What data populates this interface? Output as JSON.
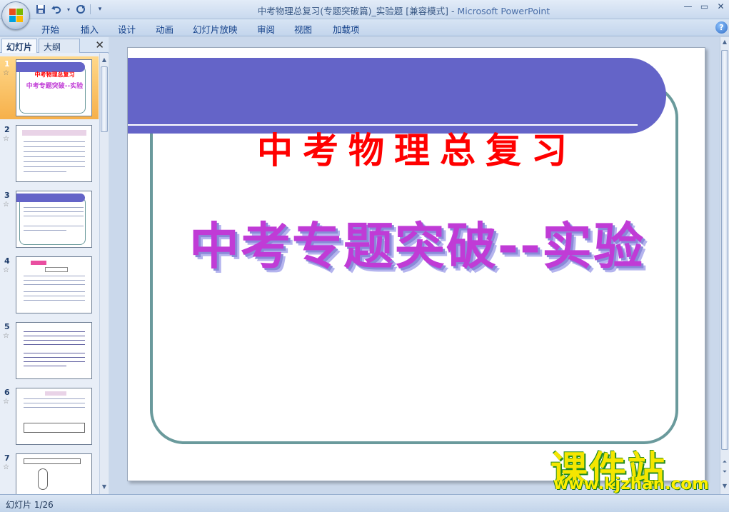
{
  "window": {
    "title": "中考物理总复习(专题突破篇)_实验题 [兼容模式]",
    "separator": " - ",
    "app_name": "Microsoft PowerPoint"
  },
  "qat": {
    "save_icon": "save-icon",
    "undo_icon": "undo-icon",
    "redo_icon": "redo-icon",
    "customize_icon": "customize-icon"
  },
  "ribbon": {
    "tabs": [
      "开始",
      "插入",
      "设计",
      "动画",
      "幻灯片放映",
      "审阅",
      "视图",
      "加载项"
    ],
    "help_label": "?"
  },
  "left_pane": {
    "tab_slides": "幻灯片",
    "tab_outline": "大纲",
    "close_label": "✕",
    "thumbnails": [
      {
        "num": "1",
        "selected": true
      },
      {
        "num": "2"
      },
      {
        "num": "3"
      },
      {
        "num": "4"
      },
      {
        "num": "5"
      },
      {
        "num": "6"
      },
      {
        "num": "7"
      }
    ],
    "thumb1_title": "中考物理总复习",
    "thumb1_subtitle": "中考专题突破--实验"
  },
  "slide": {
    "title": "中考物理总复习",
    "subtitle": "中考专题突破--实验",
    "colors": {
      "banner": "#6464c8",
      "title": "#ff0000",
      "subtitle": "#c03bd6",
      "frame": "#6a9a9c"
    }
  },
  "watermark": {
    "line1": "课件站",
    "line2": "www.kjzhan.com"
  },
  "status": {
    "slide_indicator": "幻灯片 1/26"
  }
}
